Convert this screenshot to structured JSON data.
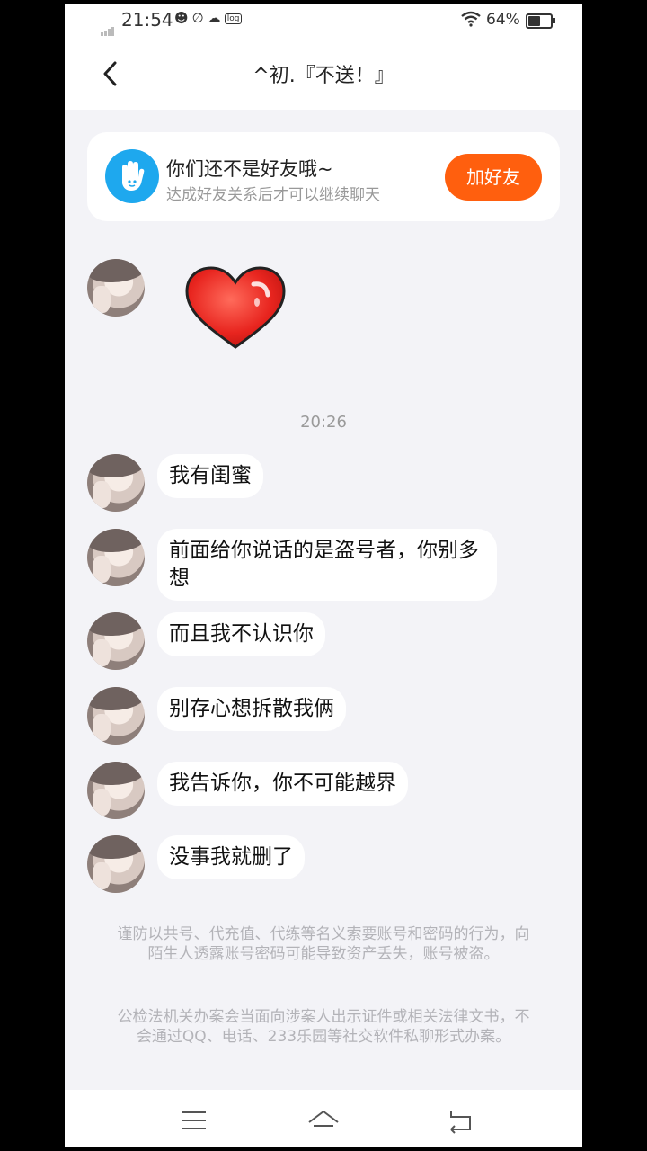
{
  "status_bar": {
    "time": "21:54",
    "battery": "64%",
    "battery_level": 0.64,
    "app_icons": [
      "emoji-face-icon",
      "app-icon",
      "cloud-icon",
      "log-icon"
    ],
    "log_label": "log"
  },
  "header": {
    "title": "^初.『不送！』"
  },
  "friend_banner": {
    "title": "你们还不是好友哦~",
    "subtitle": "达成好友关系后才可以继续聊天",
    "add_button": "加好友",
    "icon_color": "#1ea8ee",
    "button_color": "#ff5f0e"
  },
  "chat": {
    "first_message_sticker": "heart-sticker",
    "timestamp": "20:26",
    "messages": [
      "我有闺蜜",
      "前面给你说话的是盗号者，你别多想",
      "而且我不认识你",
      "别存心想拆散我俩",
      "我告诉你，你不可能越界",
      "没事我就删了"
    ]
  },
  "notices": [
    "谨防以共号、代充值、代练等名义索要账号和密码的行为，向陌生人透露账号密码可能导致资产丢失，账号被盗。",
    "公检法机关办案会当面向涉案人出示证件或相关法律文书，不会通过QQ、电话、233乐园等社交软件私聊形式办案。"
  ],
  "nav_bar": {
    "buttons": [
      "menu-icon",
      "home-icon",
      "back-icon"
    ]
  }
}
